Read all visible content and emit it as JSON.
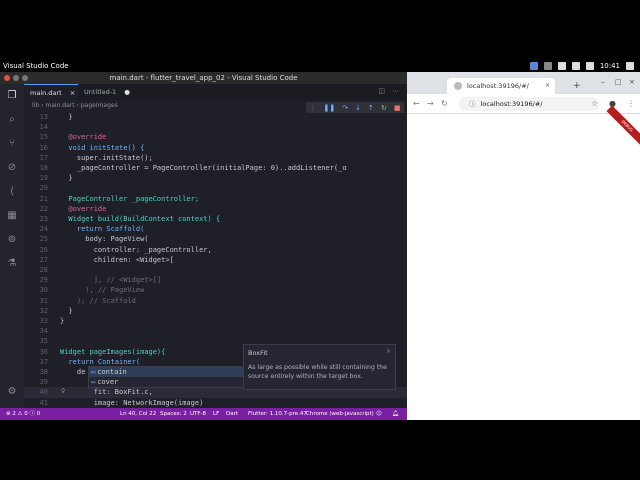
{
  "system": {
    "app_name": "Visual Studio Code",
    "clock": "10:41"
  },
  "vscode": {
    "title": "main.dart - flutter_travel_app_02 - Visual Studio Code",
    "tabs": [
      {
        "label": "main.dart"
      },
      {
        "label": "Untitled-1"
      }
    ],
    "breadcrumbs": [
      "lib",
      "main.dart",
      "pageImages"
    ],
    "lines": [
      {
        "n": "13",
        "code": "  }"
      },
      {
        "n": "14",
        "code": ""
      },
      {
        "n": "15",
        "code": "  @override"
      },
      {
        "n": "16",
        "code": "  void initState() {"
      },
      {
        "n": "17",
        "code": "    super.initState();"
      },
      {
        "n": "18",
        "code": "    _pageController = PageController(initialPage: 0)..addListener(_o"
      },
      {
        "n": "19",
        "code": "  }"
      },
      {
        "n": "20",
        "code": ""
      },
      {
        "n": "21",
        "code": "  PageController _pageController;"
      },
      {
        "n": "22",
        "code": "  @override"
      },
      {
        "n": "23",
        "code": "  Widget build(BuildContext context) {"
      },
      {
        "n": "24",
        "code": "    return Scaffold("
      },
      {
        "n": "25",
        "code": "      body: PageView("
      },
      {
        "n": "26",
        "code": "        controller: _pageController,"
      },
      {
        "n": "27",
        "code": "        children: <Widget>["
      },
      {
        "n": "28",
        "code": ""
      },
      {
        "n": "29",
        "code": "        ], // <Widget>[]"
      },
      {
        "n": "30",
        "code": "      ), // PageView"
      },
      {
        "n": "31",
        "code": "    ); // Scaffold"
      },
      {
        "n": "32",
        "code": "  }"
      },
      {
        "n": "33",
        "code": "}"
      },
      {
        "n": "34",
        "code": ""
      },
      {
        "n": "35",
        "code": ""
      },
      {
        "n": "36",
        "code": "Widget pageImages(image){"
      },
      {
        "n": "37",
        "code": "  return Container("
      },
      {
        "n": "38",
        "code": "    de"
      },
      {
        "n": "39",
        "code": ""
      },
      {
        "n": "40",
        "code": "        fit: BoxFit.c,"
      },
      {
        "n": "41",
        "code": "        image: NetworkImage(image)"
      }
    ],
    "hover": {
      "title": "BoxFit",
      "description": "As large as possible while still containing the source entirely within the target box."
    },
    "suggestions": [
      "contain",
      "cover"
    ],
    "status": {
      "left": "⊗ 2 ⚠ 0 ⓘ 0",
      "position": "Ln 40, Col 22",
      "spaces": "Spaces: 2",
      "encoding": "UTF-8",
      "eol": "LF",
      "language": "Dart",
      "flutter": "Flutter: 1.10.7-pre.47",
      "device": "Chrome (web-javascript)"
    }
  },
  "chrome": {
    "tab_title": "localhost:39196/#/",
    "url": "localhost:39196/#/",
    "ribbon": "DEBUG"
  }
}
